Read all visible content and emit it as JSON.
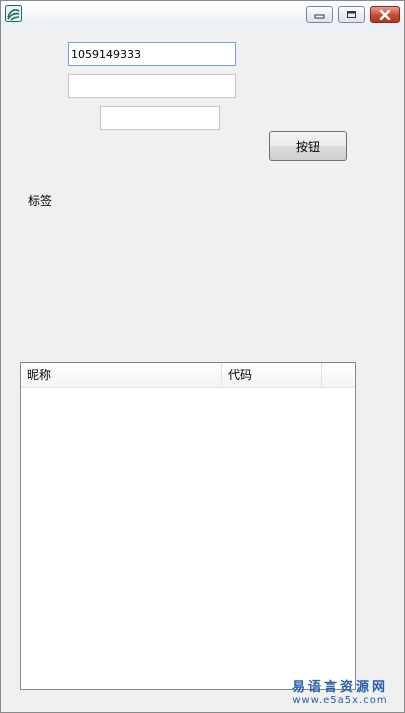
{
  "window": {
    "title": ""
  },
  "inputs": {
    "field1_value": "1059149333",
    "field2_value": "",
    "field3_value": ""
  },
  "button": {
    "label": "按钮"
  },
  "label": {
    "text": "标签"
  },
  "listview": {
    "columns": [
      "昵称",
      "代码",
      ""
    ],
    "rows": []
  },
  "watermark": {
    "name": "易语言资源网",
    "url": "www.e5a5x.com"
  },
  "colors": {
    "close_button": "#c64a33",
    "watermark": "#2a5ea8",
    "focus_border": "#7da2ce"
  },
  "icons": {
    "app": "app-logo-icon",
    "minimize": "minimize-icon",
    "maximize": "maximize-icon",
    "close": "close-icon"
  }
}
